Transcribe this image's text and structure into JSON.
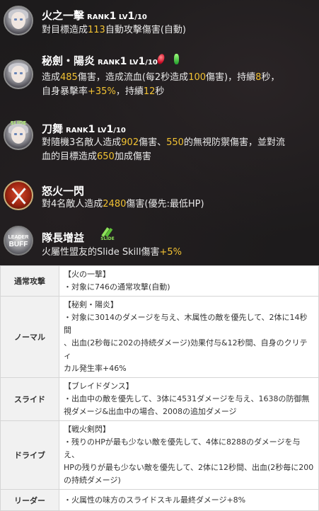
{
  "skills": [
    {
      "name": "火之一擊",
      "rank_label": "RANK",
      "rank": "1",
      "lv_label": "LV",
      "lv": "1",
      "lv_max": "/10",
      "desc": [
        [
          {
            "t": "對目標造成"
          },
          {
            "t": "113",
            "c": "hl"
          },
          {
            "t": "自動攻擊傷害(自動)"
          }
        ]
      ]
    },
    {
      "name": "秘劍・陽炎",
      "rank_label": "RANK",
      "rank": "1",
      "lv_label": "LV",
      "lv": "1",
      "lv_max": "/10",
      "desc": [
        [
          {
            "t": "造成"
          },
          {
            "t": "485",
            "c": "hl"
          },
          {
            "t": "傷害，造成流血(每2秒造成"
          },
          {
            "t": "100",
            "c": "hl"
          },
          {
            "t": "傷害)，持續"
          },
          {
            "t": "8",
            "c": "hl"
          },
          {
            "t": "秒，"
          }
        ],
        [
          {
            "t": "自身暴擊率"
          },
          {
            "t": "+35%",
            "c": "hl"
          },
          {
            "t": "，持續"
          },
          {
            "t": "12",
            "c": "hl"
          },
          {
            "t": "秒"
          }
        ]
      ]
    },
    {
      "name": "刀舞",
      "rank_label": "RANK",
      "rank": "1",
      "lv_label": "LV",
      "lv": "1",
      "lv_max": "/10",
      "icon_badge": "SLIDE",
      "desc": [
        [
          {
            "t": "對隨機3名敵人造成"
          },
          {
            "t": "902",
            "c": "hl"
          },
          {
            "t": "傷害、"
          },
          {
            "t": "550",
            "c": "hl"
          },
          {
            "t": "的無視防禦傷害，並對流"
          }
        ],
        [
          {
            "t": "血的目標造成"
          },
          {
            "t": "650",
            "c": "hl"
          },
          {
            "t": "加成傷害"
          }
        ]
      ]
    },
    {
      "name": "怒火一閃",
      "desc": [
        [
          {
            "t": "對4名敵人造成"
          },
          {
            "t": "2480",
            "c": "hl"
          },
          {
            "t": "傷害(優先:最低HP)"
          }
        ]
      ]
    },
    {
      "name": "隊長增益",
      "icon_text": [
        "LEADER",
        "BUFF"
      ],
      "slide_badge": "SLIDE",
      "desc": [
        [
          {
            "t": "火屬性盟友的Slide Skill傷害"
          },
          {
            "t": "+5%",
            "c": "hl"
          }
        ]
      ]
    }
  ],
  "table": [
    {
      "label": "通常攻撃",
      "name": "【火の一撃】",
      "lines": [
        "・対象に746の通常攻撃(自動)"
      ]
    },
    {
      "label": "ノーマル",
      "name": "【秘剣・陽炎】",
      "lines": [
        "・対象に3014のダメージを与え、木属性の敵を優先して、2体に14秒間",
        "、出血(2秒毎に202の持続ダメージ)効果付与&12秒間、自身のクリティ",
        "カル発生率+46%"
      ]
    },
    {
      "label": "スライド",
      "name": "【ブレイドダンス】",
      "lines": [
        "・出血中の敵を優先して、3体に4531ダメージを与え、1638の防御無",
        "視ダメージ&出血中の場合、2008の追加ダメージ"
      ]
    },
    {
      "label": "ドライブ",
      "name": "【戦火剣閃】",
      "lines": [
        "・残りのHPが最も少ない敵を優先して、4体に8288のダメージを与え、",
        "HPの残りが最も少ない敵を優先して、2体に12秒間、出血(2秒毎に200",
        "の持続ダメージ)"
      ]
    },
    {
      "label": "リーダー",
      "name": "",
      "lines": [
        "・火属性の味方のスライドスキル最終ダメージ+8%"
      ]
    }
  ]
}
